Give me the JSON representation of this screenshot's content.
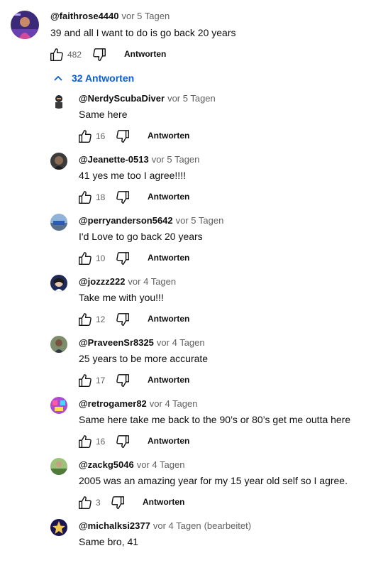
{
  "top_comment": {
    "author": "@faithrose4440",
    "time": "vor 5 Tagen",
    "text": "39 and all I want to do is go back 20 years",
    "likes": "482",
    "reply_label": "Antworten"
  },
  "replies_toggle": {
    "label": "32 Antworten",
    "icon": "chevron-up-icon"
  },
  "replies": [
    {
      "author": "@NerdyScubaDiver",
      "time": "vor 5 Tagen",
      "edited": "",
      "text": "Same here",
      "likes": "16",
      "reply_label": "Antworten"
    },
    {
      "author": "@Jeanette-0513",
      "time": "vor 5 Tagen",
      "edited": "",
      "text": "41 yes me too I agree!!!!",
      "likes": "18",
      "reply_label": "Antworten"
    },
    {
      "author": "@perryanderson5642",
      "time": "vor 5 Tagen",
      "edited": "",
      "text": "I'd Love to go back 20 years",
      "likes": "10",
      "reply_label": "Antworten"
    },
    {
      "author": "@jozzz222",
      "time": "vor 4 Tagen",
      "edited": "",
      "text": "Take me with you!!!",
      "likes": "12",
      "reply_label": "Antworten"
    },
    {
      "author": "@PraveenSr8325",
      "time": "vor 4 Tagen",
      "edited": "",
      "text": "25 years to be more accurate",
      "likes": "17",
      "reply_label": "Antworten"
    },
    {
      "author": "@retrogamer82",
      "time": "vor 4 Tagen",
      "edited": "",
      "text": "Same here take me back to the 90’s or 80’s get me outta here",
      "likes": "16",
      "reply_label": "Antworten"
    },
    {
      "author": "@zackg5046",
      "time": "vor 4 Tagen",
      "edited": "",
      "text": "2005 was an amazing year for my 15 year old self so I agree.",
      "likes": "3",
      "reply_label": "Antworten"
    },
    {
      "author": "@michalksi2377",
      "time": "vor 4 Tagen",
      "edited": "(bearbeitet)",
      "text": "Same bro, 41",
      "likes": "",
      "reply_label": ""
    }
  ],
  "icons": {
    "like": "thumbs-up-icon",
    "dislike": "thumbs-down-icon"
  },
  "colors": {
    "link": "#065fd4",
    "secondary_text": "#606060",
    "primary_text": "#0f0f0f"
  }
}
